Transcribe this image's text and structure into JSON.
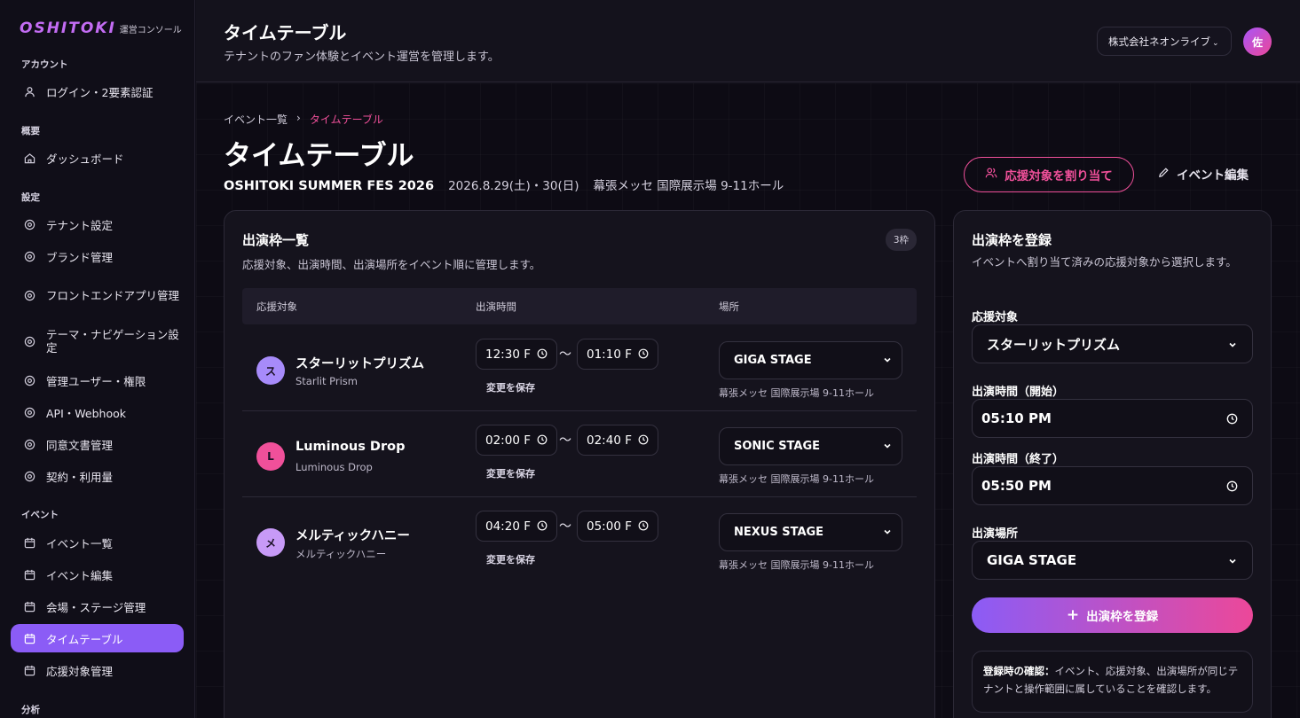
{
  "brand": {
    "logo": "OSHITOKI",
    "subtitle": "運営コンソール"
  },
  "sidebar": {
    "sections": [
      {
        "label": "アカウント"
      },
      {
        "label": "概要"
      },
      {
        "label": "設定"
      },
      {
        "label": "イベント"
      },
      {
        "label": "分析"
      }
    ],
    "items": [
      {
        "label": "ログイン・2要素認証",
        "icon": "user-icon"
      },
      {
        "label": "ダッシュボード",
        "icon": "home-icon"
      },
      {
        "label": "テナント設定",
        "icon": "settings-icon"
      },
      {
        "label": "ブランド管理",
        "icon": "settings-icon"
      },
      {
        "label": "フロントエンドアプリ管理",
        "icon": "settings-icon"
      },
      {
        "label": "テーマ・ナビゲーション設定",
        "icon": "settings-icon"
      },
      {
        "label": "管理ユーザー・権限",
        "icon": "settings-icon"
      },
      {
        "label": "API・Webhook",
        "icon": "settings-icon"
      },
      {
        "label": "同意文書管理",
        "icon": "settings-icon"
      },
      {
        "label": "契約・利用量",
        "icon": "settings-icon"
      },
      {
        "label": "イベント一覧",
        "icon": "calendar-icon"
      },
      {
        "label": "イベント編集",
        "icon": "calendar-icon"
      },
      {
        "label": "会場・ステージ管理",
        "icon": "calendar-icon"
      },
      {
        "label": "タイムテーブル",
        "icon": "calendar-icon",
        "active": true
      },
      {
        "label": "応援対象管理",
        "icon": "calendar-icon"
      }
    ]
  },
  "header": {
    "title": "タイムテーブル",
    "subtitle": "テナントのファン体験とイベント運営を管理します。",
    "tenant": "株式会社ネオンライブ",
    "avatar": "佐"
  },
  "page": {
    "breadcrumb": {
      "parent": "イベント一覧",
      "current": "タイムテーブル"
    },
    "title": "タイムテーブル",
    "event_name": "OSHITOKI SUMMER FES 2026",
    "event_date": "2026.8.29(土)・30(日)",
    "event_venue": "幕張メッセ 国際展示場 9-11ホール",
    "assign_button": "応援対象を割り当て",
    "edit_button": "イベント編集"
  },
  "slots": {
    "title": "出演枠一覧",
    "description": "応援対象、出演時間、出演場所をイベント順に管理します。",
    "count": "3枠",
    "columns": [
      "応援対象",
      "出演時間",
      "場所"
    ],
    "save_label": "変更を保存",
    "tilde": "〜",
    "rows": [
      {
        "initial": "ス",
        "avatar_color": "#a78bfa",
        "name": "スターリットプリズム",
        "sub": "Starlit Prism",
        "start": "12:30 F",
        "end": "01:10 F",
        "stage": "GIGA STAGE",
        "venue": "幕張メッセ 国際展示場 9-11ホール"
      },
      {
        "initial": "L",
        "avatar_color": "#f0509a",
        "name": "Luminous Drop",
        "sub": "Luminous Drop",
        "start": "02:00 F",
        "end": "02:40 F",
        "stage": "SONIC STAGE",
        "venue": "幕張メッセ 国際展示場 9-11ホール"
      },
      {
        "initial": "メ",
        "avatar_color": "#c79af7",
        "name": "メルティックハニー",
        "sub": "メルティックハニー",
        "start": "04:20 F",
        "end": "05:00 F",
        "stage": "NEXUS STAGE",
        "venue": "幕張メッセ 国際展示場 9-11ホール"
      }
    ]
  },
  "register": {
    "title": "出演枠を登録",
    "description": "イベントへ割り当て済みの応援対象から選択します。",
    "target_label": "応援対象",
    "target_value": "スターリットプリズム",
    "start_label": "出演時間（開始）",
    "start_value": "05:10 PM",
    "end_label": "出演時間（終了）",
    "end_value": "05:50 PM",
    "stage_label": "出演場所",
    "stage_value": "GIGA STAGE",
    "submit": "出演枠を登録",
    "note_bold": "登録時の確認：",
    "note_text": "イベント、応援対象、出演場所が同じテナントと操作範囲に属していることを確認します。"
  },
  "colors": {
    "accent_purple": "#8b5cf6",
    "accent_pink": "#f0509a"
  }
}
